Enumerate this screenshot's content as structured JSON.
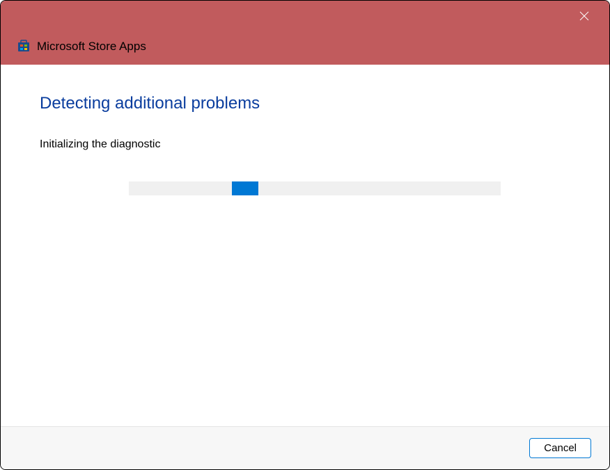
{
  "titlebar": {
    "app_title": "Microsoft Store Apps"
  },
  "content": {
    "heading": "Detecting additional problems",
    "status_text": "Initializing the diagnostic"
  },
  "footer": {
    "cancel_label": "Cancel"
  },
  "colors": {
    "titlebar_bg": "#c15b5d",
    "heading_color": "#0a3d9e",
    "progress_fill": "#0078d4",
    "button_border": "#0078d4"
  }
}
